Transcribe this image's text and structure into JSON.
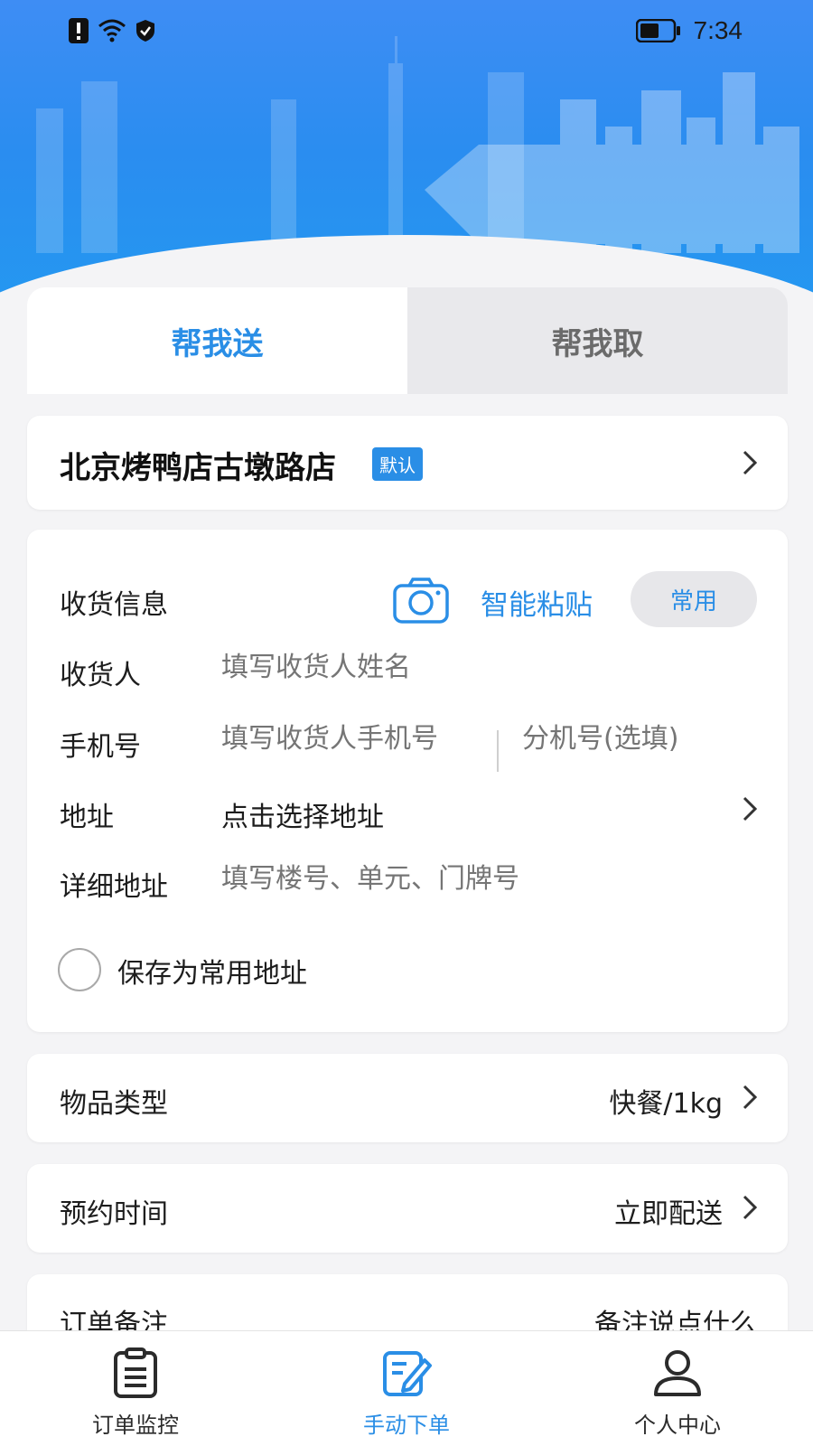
{
  "status_bar": {
    "time": "7:34",
    "icons": [
      "alert-icon",
      "wifi-icon",
      "shield-icon",
      "battery-icon"
    ]
  },
  "tabs": [
    {
      "label": "帮我送",
      "active": true
    },
    {
      "label": "帮我取",
      "active": false
    }
  ],
  "store": {
    "name": "北京烤鸭店古墩路店",
    "badge": "默认"
  },
  "receiver": {
    "section_title": "收货信息",
    "smart_paste": "智能粘贴",
    "common_button": "常用",
    "name_label": "收货人",
    "name_placeholder": "填写收货人姓名",
    "phone_label": "手机号",
    "phone_placeholder": "填写收货人手机号",
    "ext_placeholder": "分机号(选填)",
    "address_label": "地址",
    "address_value": "点击选择地址",
    "detail_label": "详细地址",
    "detail_placeholder": "填写楼号、单元、门牌号",
    "save_label": "保存为常用地址"
  },
  "item_type": {
    "label": "物品类型",
    "value": "快餐/1kg"
  },
  "schedule": {
    "label": "预约时间",
    "value": "立即配送"
  },
  "note": {
    "label": "订单备注",
    "placeholder": "备注说点什么"
  },
  "bottom_nav": [
    {
      "label": "订单监控",
      "icon": "clipboard-icon",
      "active": false
    },
    {
      "label": "手动下单",
      "icon": "edit-icon",
      "active": true
    },
    {
      "label": "个人中心",
      "icon": "user-icon",
      "active": false
    }
  ],
  "colors": {
    "accent": "#2a8ee6",
    "banner_top": "#3e8df4",
    "background": "#f4f4f6"
  }
}
